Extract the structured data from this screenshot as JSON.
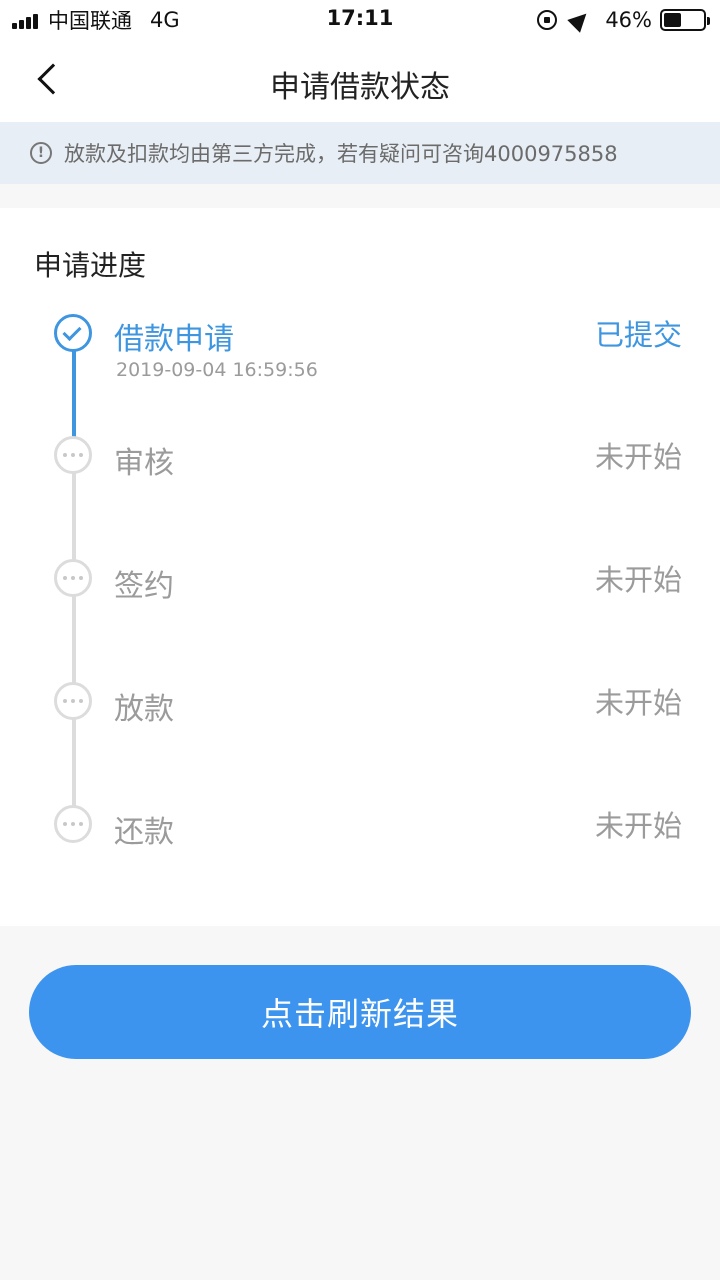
{
  "status_bar": {
    "carrier": "中国联通",
    "network": "4G",
    "time": "17:11",
    "battery": "46%",
    "battery_level": 0.46
  },
  "nav": {
    "title": "申请借款状态"
  },
  "notice": {
    "icon": "info-icon",
    "text": "放款及扣款均由第三方完成，若有疑问可咨询4000975858"
  },
  "progress": {
    "title": "申请进度",
    "steps": [
      {
        "name": "借款申请",
        "time": "2019-09-04 16:59:56",
        "status": "已提交",
        "done": true
      },
      {
        "name": "审核",
        "status": "未开始",
        "done": false
      },
      {
        "name": "签约",
        "status": "未开始",
        "done": false
      },
      {
        "name": "放款",
        "status": "未开始",
        "done": false
      },
      {
        "name": "还款",
        "status": "未开始",
        "done": false
      }
    ]
  },
  "actions": {
    "refresh_label": "点击刷新结果"
  },
  "colors": {
    "accent": "#3e95e0",
    "button": "#3d94ee",
    "pending": "#9b9b9b"
  }
}
